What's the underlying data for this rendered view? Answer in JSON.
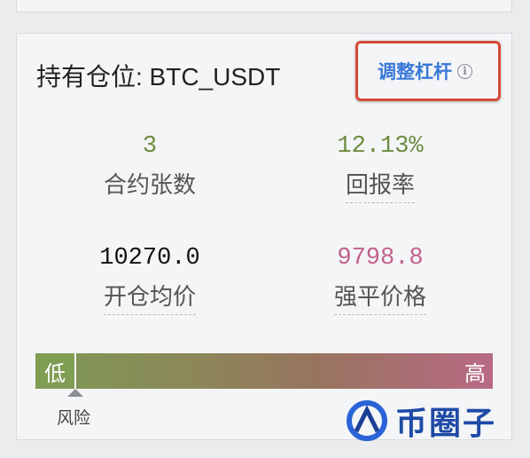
{
  "position": {
    "title": "持有仓位: BTC_USDT",
    "adjust_leverage_label": "调整杠杆",
    "info_icon_glyph": "i"
  },
  "stats": {
    "contracts": {
      "value": "3",
      "label": "合约张数",
      "color": "#6e8c3f"
    },
    "return_rate": {
      "value": "12.13%",
      "label": "回报率",
      "color": "#6e8c3f"
    },
    "avg_open_price": {
      "value": "10270.0",
      "label": "开仓均价",
      "color": "#111111"
    },
    "liquidation_price": {
      "value": "9798.8",
      "label": "强平价格",
      "color": "#c2618b"
    }
  },
  "risk": {
    "low_label": "低",
    "high_label": "高",
    "caption": "风险",
    "level": 0.05
  },
  "watermark": {
    "text": "币圈子"
  },
  "colors": {
    "accent": "#3a78d8",
    "highlight_border": "#d64a36"
  }
}
